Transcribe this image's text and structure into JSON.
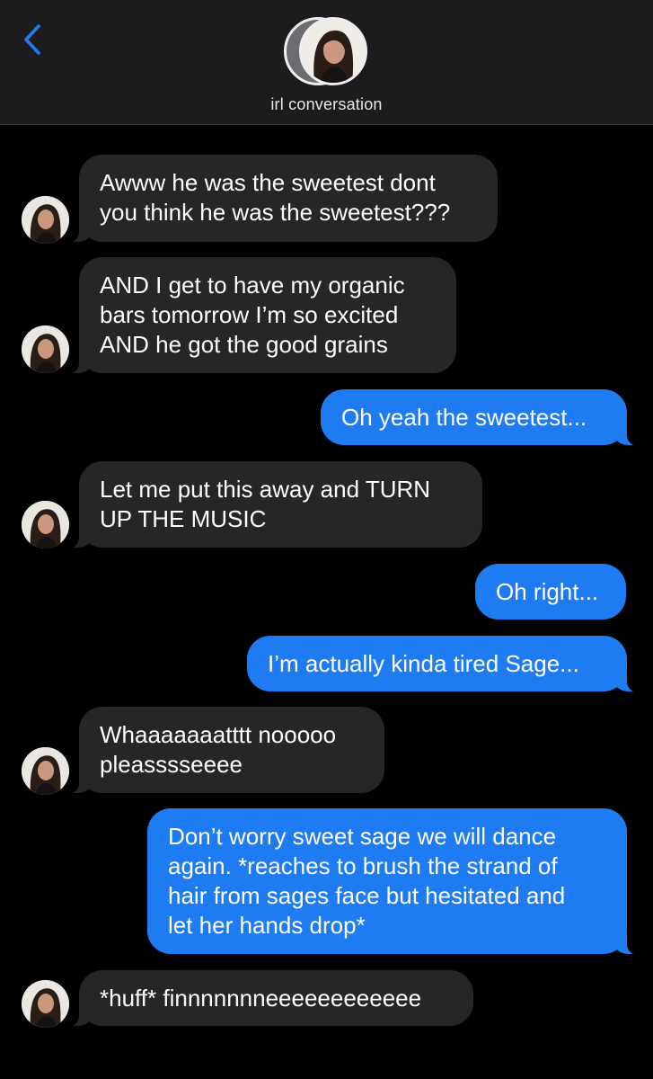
{
  "header": {
    "back_icon": "chevron-left-icon",
    "contact_name": "irl conversation",
    "accent_color": "#1f7bf2"
  },
  "messages": [
    {
      "direction": "incoming",
      "text": "Awww he was the sweetest dont\nyou think he was the sweetest???"
    },
    {
      "direction": "incoming",
      "text": "AND I get to have my organic\nbars tomorrow I’m so excited\nAND he got the good grains"
    },
    {
      "direction": "outgoing",
      "text": "Oh yeah the sweetest..."
    },
    {
      "direction": "incoming",
      "text": "Let me put this away and TURN\nUP THE MUSIC"
    },
    {
      "direction": "outgoing",
      "text": "Oh right..."
    },
    {
      "direction": "outgoing",
      "text": "I’m actually kinda tired Sage..."
    },
    {
      "direction": "incoming",
      "text": "Whaaaaaaatttt nooooo\npleasssseeee"
    },
    {
      "direction": "outgoing",
      "text": "Don’t worry sweet sage we will dance\nagain. *reaches to brush the strand of\nhair from sages face but hesitated and\nlet her hands drop*"
    },
    {
      "direction": "incoming",
      "text": "*huff* finnnnnnneeeeeeeeeeee"
    }
  ],
  "colors": {
    "incoming_bubble": "#262628",
    "outgoing_bubble": "#1f7bf2",
    "header_bg": "#1c1c1e",
    "background": "#000000"
  }
}
